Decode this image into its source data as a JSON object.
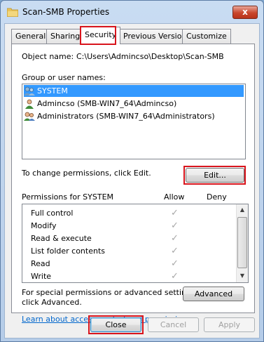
{
  "window": {
    "title": "Scan-SMB Properties",
    "close_glyph": "x"
  },
  "tabs": [
    {
      "label": "General"
    },
    {
      "label": "Sharing"
    },
    {
      "label": "Security"
    },
    {
      "label": "Previous Versions"
    },
    {
      "label": "Customize"
    }
  ],
  "active_tab": "Security",
  "object": {
    "label": "Object name:",
    "value": "C:\\Users\\Admincso\\Desktop\\Scan-SMB"
  },
  "groups": {
    "label": "Group or user names:",
    "items": [
      {
        "name": "SYSTEM",
        "selected": true
      },
      {
        "name": "Admincso (SMB-WIN7_64\\Admincso)",
        "selected": false
      },
      {
        "name": "Administrators (SMB-WIN7_64\\Administrators)",
        "selected": false
      }
    ]
  },
  "change_text": "To change permissions, click Edit.",
  "edit_button": "Edit...",
  "permissions": {
    "label": "Permissions for SYSTEM",
    "allow_header": "Allow",
    "deny_header": "Deny",
    "rows": [
      {
        "name": "Full control",
        "allow": true,
        "deny": false
      },
      {
        "name": "Modify",
        "allow": true,
        "deny": false
      },
      {
        "name": "Read & execute",
        "allow": true,
        "deny": false
      },
      {
        "name": "List folder contents",
        "allow": true,
        "deny": false
      },
      {
        "name": "Read",
        "allow": true,
        "deny": false
      },
      {
        "name": "Write",
        "allow": true,
        "deny": false
      }
    ]
  },
  "special": {
    "line1": "For special permissions or advanced settings,",
    "line2": "click Advanced."
  },
  "advanced_button": "Advanced",
  "learn_link": "Learn about access control and permissions",
  "footer": {
    "close": "Close",
    "cancel": "Cancel",
    "apply": "Apply"
  },
  "colors": {
    "highlight_box": "#d8141c",
    "selection": "#3399ff",
    "link": "#0066cc"
  }
}
